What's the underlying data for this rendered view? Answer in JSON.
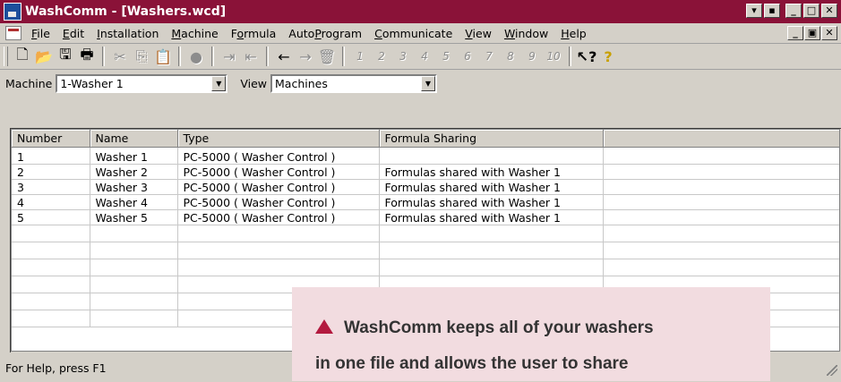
{
  "window": {
    "title": "WashComm - [Washers.wcd]"
  },
  "title_controls": [
    "▾",
    "▪",
    "_",
    "□",
    "✕"
  ],
  "menu": {
    "items": [
      {
        "u": "F",
        "rest": "ile"
      },
      {
        "u": "E",
        "rest": "dit"
      },
      {
        "u": "I",
        "rest": "nstallation"
      },
      {
        "u": "M",
        "rest": "achine"
      },
      {
        "pre": "F",
        "u": "o",
        "rest": "rmula"
      },
      {
        "pre": "Auto",
        "u": "P",
        "rest": "rogram"
      },
      {
        "u": "C",
        "rest": "ommunicate"
      },
      {
        "u": "V",
        "rest": "iew"
      },
      {
        "u": "W",
        "rest": "indow"
      },
      {
        "u": "H",
        "rest": "elp"
      }
    ],
    "controls": [
      "_",
      "▣",
      "✕"
    ]
  },
  "toolbar": {
    "new": "🗋",
    "open": "📂",
    "save": "🖫",
    "print": "🖶",
    "cut": "✂",
    "copy": "⎘",
    "paste": "📋",
    "stop": "●",
    "indent": "⇥",
    "outdent": "⇤",
    "back": "←",
    "forward": "→",
    "delete": "🗑",
    "numbers": [
      "1",
      "2",
      "3",
      "4",
      "5",
      "6",
      "7",
      "8",
      "9",
      "10"
    ],
    "context_help": "↖?",
    "help": "?"
  },
  "filters": {
    "machine_label": "Machine",
    "machine_value": "1-Washer 1",
    "view_label": "View",
    "view_value": "Machines"
  },
  "table": {
    "columns": [
      "Number",
      "Name",
      "Type",
      "Formula Sharing"
    ],
    "rows": [
      [
        "1",
        "Washer 1",
        "PC-5000 ( Washer Control )",
        ""
      ],
      [
        "2",
        "Washer 2",
        "PC-5000 ( Washer Control )",
        "Formulas shared with Washer 1"
      ],
      [
        "3",
        "Washer 3",
        "PC-5000 ( Washer Control )",
        "Formulas shared with Washer 1"
      ],
      [
        "4",
        "Washer 4",
        "PC-5000 ( Washer Control )",
        "Formulas shared with Washer 1"
      ],
      [
        "5",
        "Washer 5",
        "PC-5000 ( Washer Control )",
        "Formulas shared with Washer 1"
      ]
    ]
  },
  "status": {
    "text": "For Help, press F1"
  },
  "callout": {
    "line1": "WashComm keeps all of your washers",
    "line2": "in one file and allows the user to share"
  },
  "colors": {
    "titlebar": "#8a1238",
    "callout_bg": "#f2dce0",
    "callout_triangle": "#b31a3f"
  }
}
